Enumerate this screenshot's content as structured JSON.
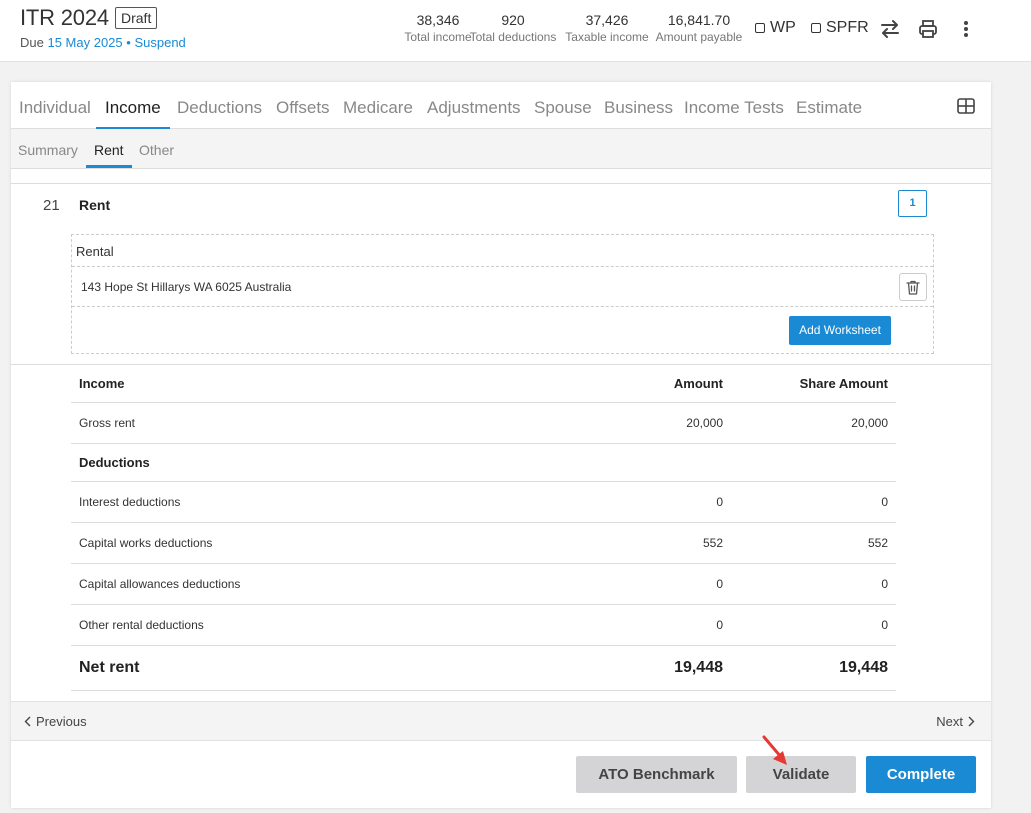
{
  "header": {
    "title": "ITR 2024",
    "status_badge": "Draft",
    "due_prefix": "Due",
    "due_date": "15 May 2025",
    "separator": "•",
    "suspend_link": "Suspend",
    "metrics": [
      {
        "value": "38,346",
        "label": "Total income"
      },
      {
        "value": "920",
        "label": "Total deductions"
      },
      {
        "value": "37,426",
        "label": "Taxable income"
      },
      {
        "value": "16,841.70",
        "label": "Amount payable"
      }
    ],
    "checkboxes": [
      {
        "label": "WP",
        "checked": false
      },
      {
        "label": "SPFR",
        "checked": false
      }
    ],
    "icons": [
      "swap-icon",
      "print-icon",
      "more-vertical-icon"
    ]
  },
  "tabs": {
    "items": [
      "Individual",
      "Income",
      "Deductions",
      "Offsets",
      "Medicare",
      "Adjustments",
      "Spouse",
      "Business",
      "Income Tests",
      "Estimate"
    ],
    "active": "Income"
  },
  "subtabs": {
    "items": [
      "Summary",
      "Rent",
      "Other"
    ],
    "active": "Rent"
  },
  "section": {
    "number": "21",
    "title": "Rent",
    "count": "1"
  },
  "rental": {
    "heading": "Rental",
    "address": "143 Hope St Hillarys WA 6025 Australia",
    "add_worksheet_label": "Add Worksheet"
  },
  "table": {
    "headers": [
      "Income",
      "Amount",
      "Share Amount"
    ],
    "gross_rent": {
      "label": "Gross rent",
      "amount": "20,000",
      "share": "20,000"
    },
    "deductions_heading": "Deductions",
    "deductions": [
      {
        "label": "Interest deductions",
        "amount": "0",
        "share": "0"
      },
      {
        "label": "Capital works deductions",
        "amount": "552",
        "share": "552"
      },
      {
        "label": "Capital allowances deductions",
        "amount": "0",
        "share": "0"
      },
      {
        "label": "Other rental deductions",
        "amount": "0",
        "share": "0"
      }
    ],
    "net_rent": {
      "label": "Net rent",
      "amount": "19,448",
      "share": "19,448"
    }
  },
  "nav": {
    "previous": "Previous",
    "next": "Next"
  },
  "actions": {
    "ato_benchmark": "ATO Benchmark",
    "validate": "Validate",
    "complete": "Complete"
  },
  "colors": {
    "accent": "#1a8ad4",
    "button_grey": "#d4d4d6",
    "annotation_arrow": "#e53935"
  }
}
